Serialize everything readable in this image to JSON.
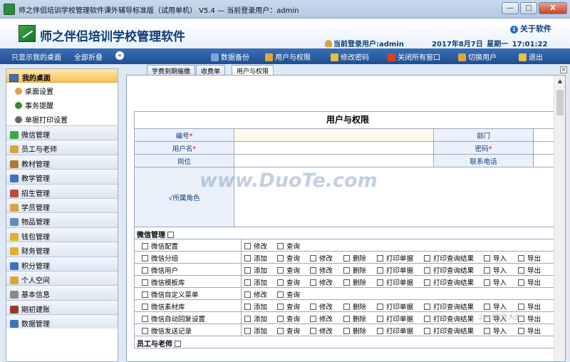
{
  "window": {
    "title": "师之伴侣培训学校管理软件课外辅导标准版（试用单机） V5.4 — 当前登录用户：admin",
    "buttons": [
      "—",
      "□",
      "X"
    ]
  },
  "header": {
    "app_name": "师之伴侣培训学校管理软件",
    "about": "关于软件",
    "current_user": "当前登录用户:admin",
    "date": "2017年8月7日",
    "weekday": "星期一",
    "time": "17:01:22"
  },
  "toolbar": {
    "show_desktop": "只显示我的桌面",
    "collapse_all": "全部折叠",
    "items": [
      {
        "label": "数据备份",
        "color": "#7aa6de"
      },
      {
        "label": "用户与权限",
        "color": "#e0a638"
      },
      {
        "label": "修改密码",
        "color": "#e0c13a"
      },
      {
        "label": "关闭所有窗口",
        "color": "#d9402a"
      },
      {
        "label": "切换用户",
        "color": "#e0a638"
      },
      {
        "label": "退出",
        "color": "#e8c24a"
      }
    ]
  },
  "sidebar": {
    "head": "我的桌面",
    "subs": [
      {
        "label": "桌面设置",
        "color": "#d9a441"
      },
      {
        "label": "事务提醒",
        "color": "#3a8a3a"
      },
      {
        "label": "单据打印设置",
        "color": "#666666"
      }
    ],
    "groups": [
      {
        "label": "微信管理",
        "color": "#35a845"
      },
      {
        "label": "员工与老师",
        "color": "#d9a441"
      },
      {
        "label": "教材管理",
        "color": "#b9772c"
      },
      {
        "label": "教学管理",
        "color": "#3d72b8"
      },
      {
        "label": "招生管理",
        "color": "#c04a3a"
      },
      {
        "label": "学员管理",
        "color": "#d9a441"
      },
      {
        "label": "物品管理",
        "color": "#6a8ab8"
      },
      {
        "label": "钱包管理",
        "color": "#e0b030"
      },
      {
        "label": "财务管理",
        "color": "#e0b030"
      },
      {
        "label": "积分管理",
        "color": "#3d72b8"
      },
      {
        "label": "个人空间",
        "color": "#d9a441"
      },
      {
        "label": "基本信息",
        "color": "#8a8a8a"
      },
      {
        "label": "期初建账",
        "color": "#9c3a2a"
      },
      {
        "label": "数据管理",
        "color": "#3d72b8"
      }
    ]
  },
  "tabs": [
    "学费到期催缴",
    "收费单",
    "用户与权限"
  ],
  "form": {
    "caption": "用户与权限",
    "fields": {
      "id_label": "编号",
      "dept_label": "部门",
      "username_label": "用户名",
      "password_label": "密码",
      "position_label": "岗位",
      "phone_label": "联系电话",
      "role_label": "√所属角色",
      "required_mark": "*"
    }
  },
  "permissions": {
    "section_wechat": "微信管理",
    "section_staff": "员工与老师",
    "op_labels": [
      "添加",
      "查询",
      "修改",
      "删除",
      "打印单据",
      "打印查询结果",
      "导入",
      "导出"
    ],
    "rows": [
      {
        "name": "微信配置",
        "ops": [
          "修改",
          "查询"
        ]
      },
      {
        "name": "微信分组",
        "ops": [
          "添加",
          "查询",
          "修改",
          "删除",
          "打印单据",
          "打印查询结果",
          "导入",
          "导出"
        ]
      },
      {
        "name": "微信用户",
        "ops": [
          "添加",
          "查询",
          "修改",
          "删除",
          "打印单据",
          "打印查询结果",
          "导入",
          "导出"
        ]
      },
      {
        "name": "微信模板库",
        "ops": [
          "添加",
          "查询",
          "修改",
          "删除",
          "打印单据",
          "打印查询结果",
          "导入",
          "导出"
        ]
      },
      {
        "name": "微信自定义菜单",
        "ops": [
          "修改",
          "查询"
        ]
      },
      {
        "name": "微信素材库",
        "ops": [
          "添加",
          "查询",
          "修改",
          "删除",
          "打印单据",
          "打印查询结果",
          "导入",
          "导出"
        ]
      },
      {
        "name": "微信自动回复设置",
        "ops": [
          "添加",
          "查询",
          "修改",
          "删除",
          "打印单据",
          "打印查询结果",
          "导入",
          "导出"
        ]
      },
      {
        "name": "微信发送记录",
        "ops": [
          "添加",
          "查询",
          "修改",
          "删除",
          "打印单据",
          "打印查询结果",
          "导入",
          "导出"
        ]
      }
    ]
  },
  "watermark": "www.DuoTe.com",
  "watermark2": "2345软件大全"
}
